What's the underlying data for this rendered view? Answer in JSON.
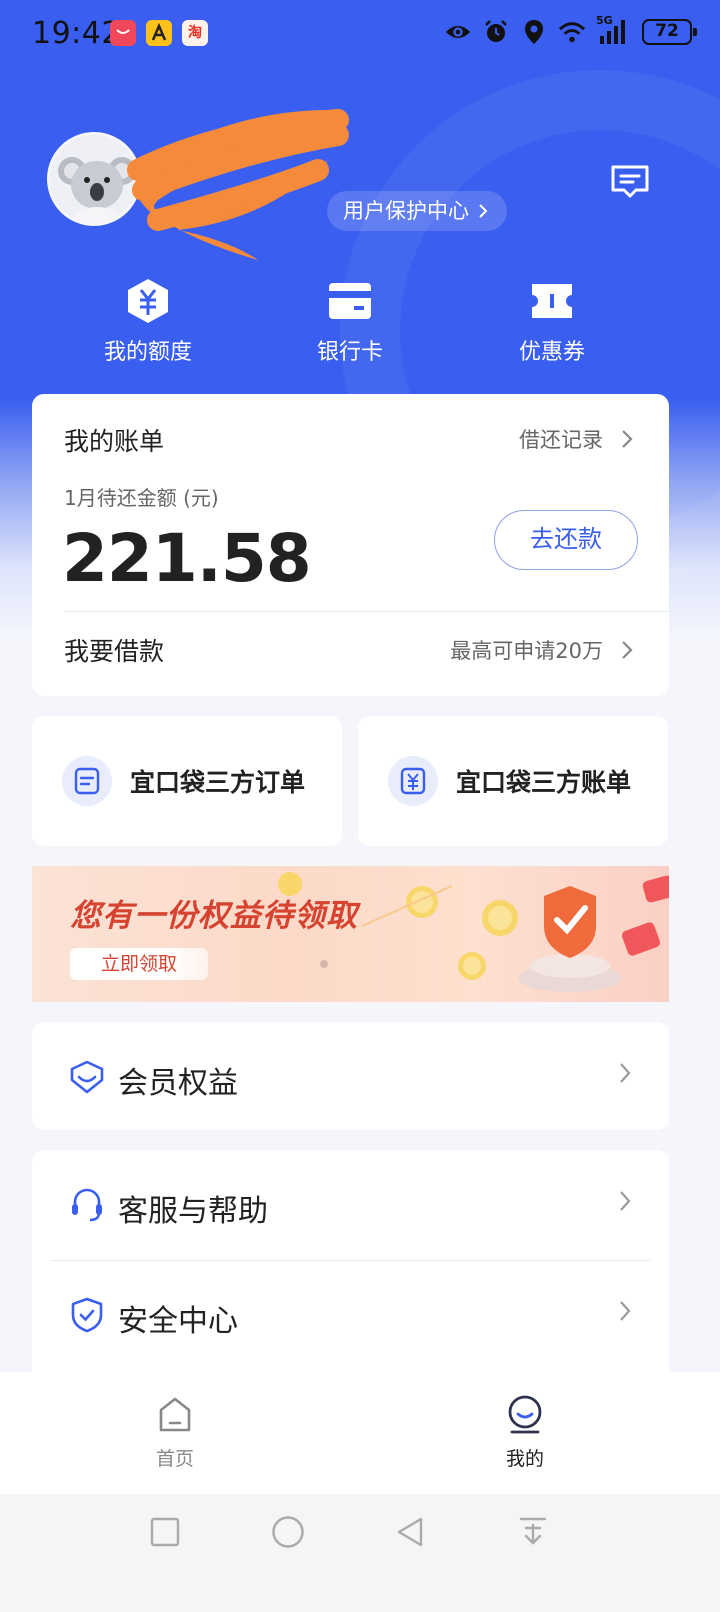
{
  "status_bar": {
    "time": "19:42",
    "network": "5G",
    "battery": "72",
    "app_icons": [
      "red-app-icon",
      "a-app-icon",
      "taobao-app-icon"
    ],
    "app_icon_text": {
      "taobao": "淘"
    }
  },
  "header": {
    "user_protection_label": "用户保护中心",
    "quick_actions": [
      {
        "label": "我的额度",
        "icon": "quota-icon"
      },
      {
        "label": "银行卡",
        "icon": "bank-card-icon"
      },
      {
        "label": "优惠券",
        "icon": "coupon-icon"
      }
    ]
  },
  "bill": {
    "title": "我的账单",
    "record_label": "借还记录",
    "subtitle": "1月待还金额 (元)",
    "amount": "221.58",
    "pay_button": "去还款",
    "borrow_label": "我要借款",
    "borrow_info": "最高可申请20万"
  },
  "orders": {
    "third_party_orders": "宜口袋三方订单",
    "third_party_bills": "宜口袋三方账单"
  },
  "banner": {
    "title": "您有一份权益待领取",
    "button": "立即领取"
  },
  "menu": [
    {
      "label": "会员权益",
      "icon": "member-icon"
    },
    {
      "label": "客服与帮助",
      "icon": "headset-icon"
    },
    {
      "label": "安全中心",
      "icon": "shield-icon"
    }
  ],
  "bottom_nav": {
    "home": "首页",
    "mine": "我的"
  },
  "colors": {
    "primary": "#3a5ff0",
    "text": "#222222",
    "banner_red": "#d64330"
  }
}
